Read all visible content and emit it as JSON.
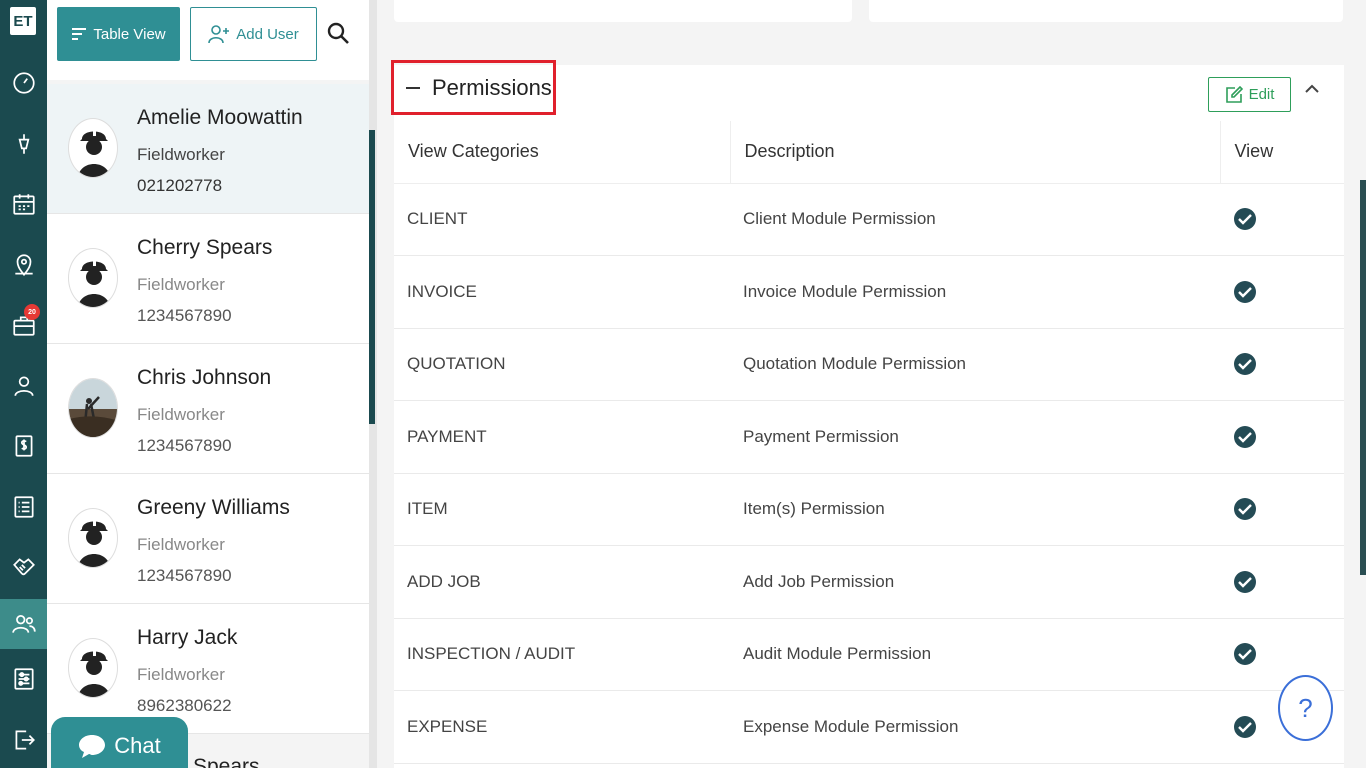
{
  "app": {
    "logo_text": "ET"
  },
  "nav": {
    "items": [
      {
        "icon": "dashboard-icon"
      },
      {
        "icon": "pen-tool-icon"
      },
      {
        "icon": "calendar-icon"
      },
      {
        "icon": "map-pin-icon"
      },
      {
        "icon": "briefcase-icon",
        "badge": "20"
      },
      {
        "icon": "user-icon"
      },
      {
        "icon": "dollar-icon"
      },
      {
        "icon": "list-icon"
      },
      {
        "icon": "handshake-icon"
      },
      {
        "icon": "users-icon",
        "active": true
      },
      {
        "icon": "sliders-icon"
      },
      {
        "icon": "logout-icon"
      }
    ]
  },
  "toolbar": {
    "table_view_label": "Table View",
    "add_user_label": "Add User"
  },
  "users": [
    {
      "name": "Amelie Moowattin",
      "role": "Fieldworker",
      "phone": "021202778",
      "selected": true
    },
    {
      "name": "Cherry Spears",
      "role": "Fieldworker",
      "phone": "1234567890"
    },
    {
      "name": "Chris Johnson",
      "role": "Fieldworker",
      "phone": "1234567890"
    },
    {
      "name": "Greeny Williams",
      "role": "Fieldworker",
      "phone": "1234567890"
    },
    {
      "name": "Harry Jack",
      "role": "Fieldworker",
      "phone": "8962380622"
    }
  ],
  "partial_user_name": "Spears",
  "chat": {
    "label": "Chat"
  },
  "permissions": {
    "title": "Permissions",
    "edit_label": "Edit",
    "columns": [
      "View Categories",
      "Description",
      "View"
    ],
    "rows": [
      {
        "category": "CLIENT",
        "description": "Client Module Permission",
        "view": true
      },
      {
        "category": "INVOICE",
        "description": "Invoice Module Permission",
        "view": true
      },
      {
        "category": "QUOTATION",
        "description": "Quotation Module Permission",
        "view": true
      },
      {
        "category": "PAYMENT",
        "description": "Payment Permission",
        "view": true
      },
      {
        "category": "ITEM",
        "description": "Item(s) Permission",
        "view": true
      },
      {
        "category": "ADD JOB",
        "description": "Add Job Permission",
        "view": true
      },
      {
        "category": "INSPECTION / AUDIT",
        "description": "Audit Module Permission",
        "view": true
      },
      {
        "category": "EXPENSE",
        "description": "Expense Module Permission",
        "view": true
      }
    ]
  },
  "help": {
    "label": "?"
  },
  "colors": {
    "rail": "#1b4a4f",
    "accent": "#2f8f94",
    "highlight_border": "#e0202c",
    "edit_green": "#2e9e5a",
    "check": "#244b55"
  }
}
